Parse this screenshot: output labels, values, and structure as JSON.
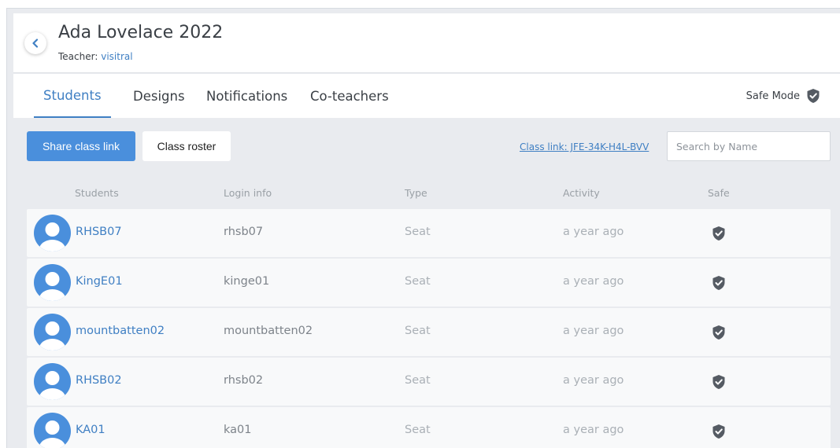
{
  "header": {
    "title": "Ada Lovelace 2022",
    "teacher_label": "Teacher:",
    "teacher_name": "visitral"
  },
  "tabs": [
    {
      "label": "Students",
      "active": true
    },
    {
      "label": "Designs",
      "active": false
    },
    {
      "label": "Notifications",
      "active": false
    },
    {
      "label": "Co-teachers",
      "active": false
    }
  ],
  "safe_mode": {
    "label": "Safe Mode",
    "icon": "shield-check-icon"
  },
  "toolbar": {
    "share_label": "Share class link",
    "roster_label": "Class roster",
    "class_link": "Class link: JFE-34K-H4L-BVV",
    "search_placeholder": "Search by Name"
  },
  "table": {
    "columns": [
      "Students",
      "Login info",
      "Type",
      "Activity",
      "Safe"
    ],
    "rows": [
      {
        "name": "RHSB07",
        "login": "rhsb07",
        "type": "Seat",
        "activity": "a year ago"
      },
      {
        "name": "KingE01",
        "login": "kinge01",
        "type": "Seat",
        "activity": "a year ago"
      },
      {
        "name": "mountbatten02",
        "login": "mountbatten02",
        "type": "Seat",
        "activity": "a year ago"
      },
      {
        "name": "RHSB02",
        "login": "rhsb02",
        "type": "Seat",
        "activity": "a year ago"
      },
      {
        "name": "KA01",
        "login": "ka01",
        "type": "Seat",
        "activity": "a year ago"
      }
    ]
  },
  "colors": {
    "accent": "#4a8fdc",
    "link": "#3f7fc3",
    "background": "#e9ebef",
    "shield": "#555b63"
  }
}
